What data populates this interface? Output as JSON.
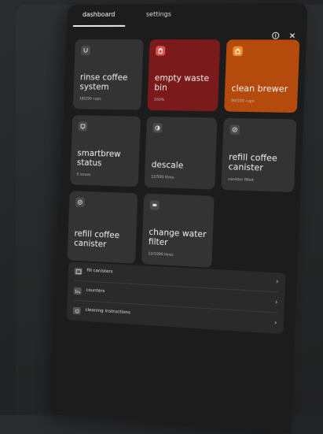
{
  "tabs": [
    {
      "label": "dashboard",
      "active": true
    },
    {
      "label": "settings",
      "active": false
    }
  ],
  "header_icons": [
    "info-icon",
    "close-icon"
  ],
  "tiles": [
    {
      "title": "rinse coffee system",
      "sub": "18/250 cups",
      "icon": "rinse-icon",
      "color": "#333334"
    },
    {
      "title": "empty waste bin",
      "sub": "100%",
      "icon": "trash-icon",
      "color": "#7a1a1a"
    },
    {
      "title": "clean brewer",
      "sub": "90/100 cups",
      "icon": "brewer-icon",
      "color": "#b44b0d"
    },
    {
      "title": "smartbrew status",
      "sub": "0 issues",
      "icon": "status-icon",
      "color": "#333334"
    },
    {
      "title": "descale",
      "sub": "12/500 litres",
      "icon": "drop-icon",
      "color": "#333334"
    },
    {
      "title": "refill coffee canister",
      "sub": "canister filled",
      "icon": "canister-icon",
      "color": "#333334"
    },
    {
      "title": "refill coffee canister",
      "sub": "",
      "icon": "canister-icon",
      "color": "#333334"
    },
    {
      "title": "change water filter",
      "sub": "12/1000 litres",
      "icon": "filter-icon",
      "color": "#333334"
    }
  ],
  "list": [
    {
      "label": "fill canisters",
      "icon": "canister-list-icon"
    },
    {
      "label": "counters",
      "icon": "counter-icon"
    },
    {
      "label": "cleaning instructions",
      "icon": "cleaning-icon"
    }
  ],
  "chevron": "›"
}
